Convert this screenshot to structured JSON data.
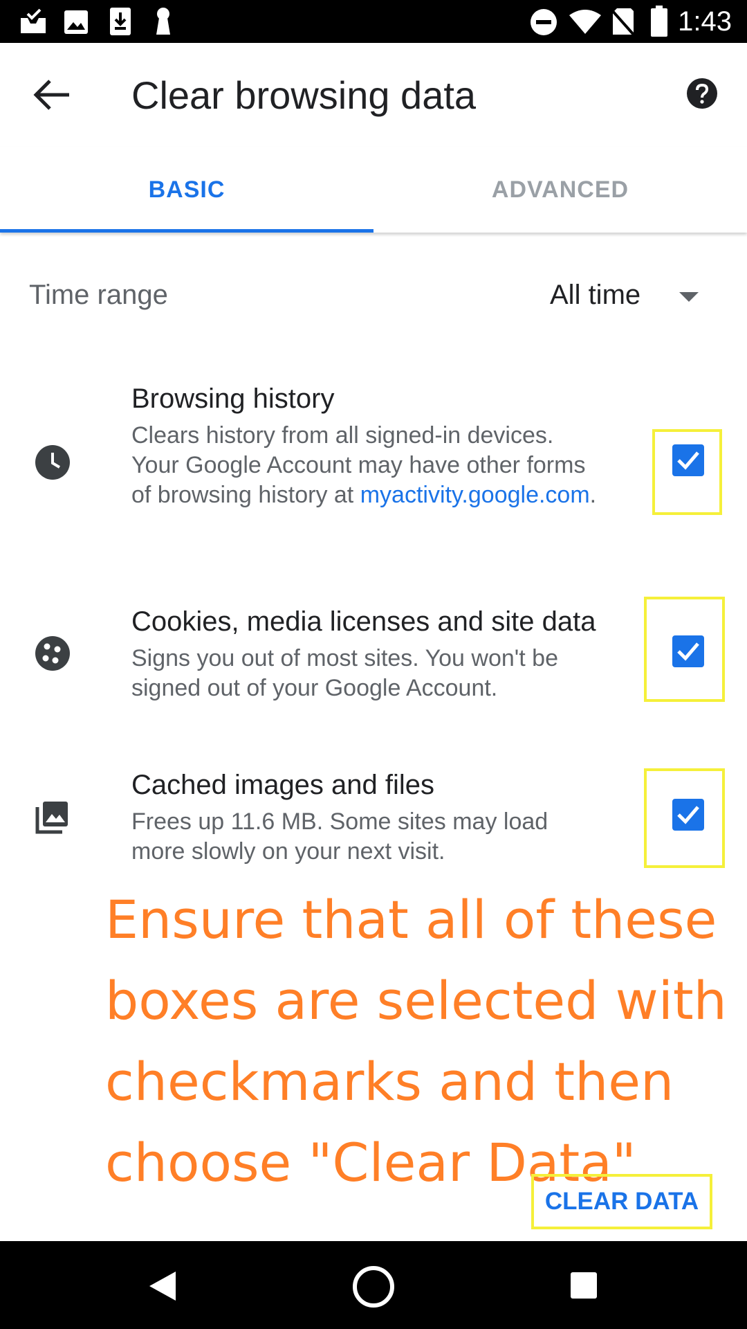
{
  "status_bar": {
    "time": "1:43",
    "left_icons": [
      "inbox-check-icon",
      "image-icon",
      "download-icon",
      "keyhole-icon"
    ],
    "right_icons": [
      "do-not-disturb-icon",
      "wifi-icon",
      "no-sim-icon",
      "battery-icon"
    ]
  },
  "app_bar": {
    "title": "Clear browsing data",
    "back_icon": "arrow-back-icon",
    "help_icon": "help-icon"
  },
  "tabs": [
    {
      "label": "BASIC",
      "selected": true
    },
    {
      "label": "ADVANCED",
      "selected": false
    }
  ],
  "time_range": {
    "label": "Time range",
    "value": "All time"
  },
  "items": [
    {
      "icon": "clock-icon",
      "title": "Browsing history",
      "description": "Clears history from all signed-in devices. Your Google Account may have other forms of browsing history at",
      "link": "myactivity.google.com",
      "link_suffix": ".",
      "checked": true
    },
    {
      "icon": "cookie-icon",
      "title": "Cookies, media licenses and site data",
      "description": "Signs you out of most sites. You won't be signed out of your Google Account.",
      "checked": true
    },
    {
      "icon": "images-icon",
      "title": "Cached images and files",
      "description": "Frees up 11.6 MB. Some sites may load more slowly on your next visit.",
      "checked": true
    }
  ],
  "annotation": "Ensure that all of these boxes are selected with checkmarks and then choose \"Clear Data\"",
  "clear_button": "CLEAR DATA",
  "colors": {
    "accent": "#1a73e8",
    "highlight": "#f5f03a",
    "annotation": "#ff7f27"
  },
  "nav_bar": [
    "back-triangle-icon",
    "home-circle-icon",
    "recents-square-icon"
  ]
}
